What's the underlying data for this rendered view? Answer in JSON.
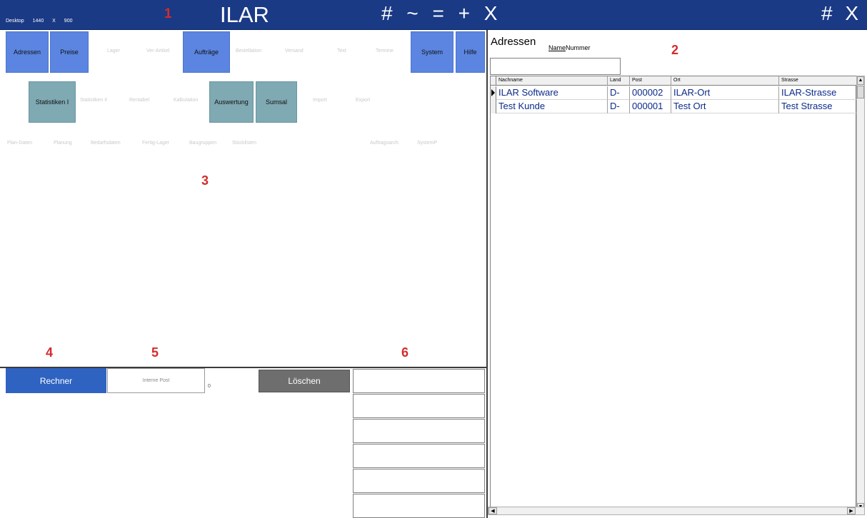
{
  "titlebar": {
    "desktop_label": "Desktop",
    "res_w": "1440",
    "res_x": "X",
    "res_h": "900",
    "app_title": "ILAR",
    "controls": [
      "#",
      "~",
      "=",
      "+",
      "X"
    ],
    "right_controls": [
      "#",
      "X"
    ]
  },
  "markers": [
    "1",
    "2",
    "3",
    "4",
    "5",
    "6"
  ],
  "nav_row1": [
    {
      "label": "Adressen",
      "style": "blue"
    },
    {
      "label": "Preise",
      "style": "blue"
    },
    {
      "label": "Lager",
      "style": "ghost"
    },
    {
      "label": "Ver-Artikel",
      "style": "ghost"
    },
    {
      "label": "Aufträge",
      "style": "blue"
    },
    {
      "label": "Bestellation",
      "style": "ghost"
    },
    {
      "label": "Versand",
      "style": "ghost"
    },
    {
      "label": "Text",
      "style": "ghost"
    },
    {
      "label": "Termine",
      "style": "ghost"
    },
    {
      "label": "System",
      "style": "blue"
    },
    {
      "label": "Hilfe",
      "style": "blue"
    }
  ],
  "nav_row2": [
    {
      "label": "Statistiken I",
      "style": "teal"
    },
    {
      "label": "Statistiken II",
      "style": "ghost"
    },
    {
      "label": "Rentabel",
      "style": "ghost"
    },
    {
      "label": "Kalkulation",
      "style": "ghost"
    },
    {
      "label": "Auswertung",
      "style": "teal"
    },
    {
      "label": "Sumsal",
      "style": "teal"
    },
    {
      "label": "Import",
      "style": "ghost"
    },
    {
      "label": "Export",
      "style": "ghost"
    }
  ],
  "nav_row3": [
    "Plan-Daten",
    "Planung",
    "Bedarfsdaten",
    "Fertig-Lager",
    "Baugruppen",
    "Stücklisten",
    "Auftragsarch.",
    "SystemP"
  ],
  "right_panel": {
    "title": "Adressen",
    "tab_name": "Name",
    "tab_nummer": "Nummer",
    "search_value": ""
  },
  "table": {
    "headers": [
      "Nachname",
      "Land",
      "Post",
      "Ort",
      "Strasse"
    ],
    "rows": [
      [
        "ILAR Software",
        "D-",
        "000002",
        "ILAR-Ort",
        "ILAR-Strasse"
      ],
      [
        "Test Kunde",
        "D-",
        "000001",
        "Test Ort",
        "Test Strasse"
      ]
    ]
  },
  "bottom": {
    "rechner": "Rechner",
    "interne_post": "Interne Post",
    "interne_post_value": "0",
    "loeschen": "Löschen"
  },
  "colors": {
    "titlebar": "#1a3a85",
    "nav_blue": "#5b85e0",
    "nav_teal": "#7fa9b3",
    "rechner": "#2f63c2",
    "loeschen": "#6e6e6e",
    "marker": "#d42b2b",
    "grid_text": "#0a2a8a"
  }
}
